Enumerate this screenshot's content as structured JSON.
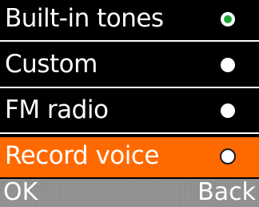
{
  "options": [
    {
      "label": "Built-in tones",
      "selected": true,
      "focused": false
    },
    {
      "label": "Custom",
      "selected": false,
      "focused": false
    },
    {
      "label": "FM radio",
      "selected": false,
      "focused": false
    },
    {
      "label": "Record voice",
      "selected": false,
      "focused": true
    }
  ],
  "softkeys": {
    "left": "OK",
    "right": "Back"
  },
  "colors": {
    "background": "#000000",
    "text": "#ffffff",
    "focus_highlight": "#ff6a00",
    "selected_dot": "#1aa832",
    "softkey_bar": "#8c8c8c"
  },
  "icons": {
    "radio": "radio-button-icon"
  }
}
